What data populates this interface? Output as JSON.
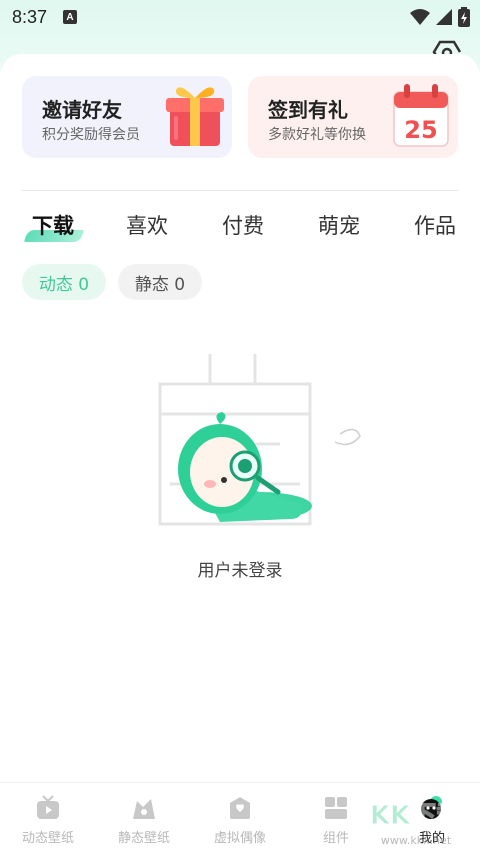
{
  "status_bar": {
    "time": "8:37",
    "a_badge": "A"
  },
  "promos": [
    {
      "title": "邀请好友",
      "subtitle": "积分奖励得会员",
      "icon": "gift-box-icon"
    },
    {
      "title": "签到有礼",
      "subtitle": "多款好礼等你换",
      "icon": "calendar-icon",
      "calendar_day": "25"
    }
  ],
  "tabs": [
    {
      "label": "下载",
      "active": true
    },
    {
      "label": "喜欢",
      "active": false
    },
    {
      "label": "付费",
      "active": false
    },
    {
      "label": "萌宠",
      "active": false
    },
    {
      "label": "作品",
      "active": false
    }
  ],
  "chips": [
    {
      "label": "动态 0",
      "active": true
    },
    {
      "label": "静态 0",
      "active": false
    }
  ],
  "empty_state": {
    "message": "用户未登录",
    "illustration": "mascot-with-magnifier"
  },
  "bottom_nav": [
    {
      "label": "动态壁纸",
      "icon": "tv-icon",
      "active": false
    },
    {
      "label": "静态壁纸",
      "icon": "image-icon",
      "active": false
    },
    {
      "label": "虚拟偶像",
      "icon": "idol-icon",
      "active": false
    },
    {
      "label": "组件",
      "icon": "widget-icon",
      "active": false
    },
    {
      "label": "我的",
      "icon": "profile-icon",
      "active": true
    }
  ],
  "colors": {
    "accent": "#3fc99a",
    "accent_light": "#e7f8f1",
    "invite_bg": "#f1f2fb",
    "signin_bg": "#fdf0ef"
  },
  "watermark": {
    "line1": "KK下载",
    "line2": "www.kkx.net"
  }
}
